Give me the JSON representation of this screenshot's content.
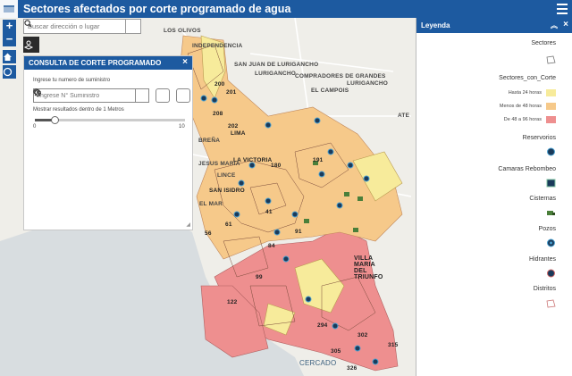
{
  "header": {
    "title": "Sectores afectados por corte programado de agua"
  },
  "search": {
    "placeholder": "Buscar dirección o lugar"
  },
  "map": {
    "labels": [
      "LOS OLIVOS",
      "INDEPENDENCIA",
      "SAN JUAN DE LURIGANCHO",
      "LURIGANCHO",
      "COMPRADORES DE GRANDES",
      "EL CAMPOIS",
      "LURIGANCHO",
      "ATE",
      "BREÑA",
      "LIMA",
      "LA VICTORIA",
      "JESUS MARIA",
      "LINCE",
      "SAN ISIDRO",
      "EL MAR",
      "VILLA MARIA DEL TRIUNFO",
      "CERCADO"
    ],
    "sector_numbers": [
      "201",
      "208",
      "202",
      "200",
      "191",
      "180",
      "61",
      "41",
      "56",
      "99",
      "122",
      "84",
      "315",
      "326",
      "302",
      "305",
      "294",
      "91"
    ],
    "colors": {
      "c24": "#f7eb9b",
      "c48": "#f6c98a",
      "c96": "#ee8f8f",
      "district": "#d8a48a"
    }
  },
  "panel": {
    "title": "CONSULTA DE CORTE PROGRAMADO",
    "ingrese_label": "Ingrese tu numero de suministro",
    "input_placeholder": "Ingrese N° Suministro",
    "results_label": "Mostrar resultados dentro de 1 Metros",
    "slider_min": "0",
    "slider_max": "10",
    "slider_value_fraction": 0.1
  },
  "legend": {
    "title": "Leyenda",
    "sectores": "Sectores",
    "sectores_con_corte": "Sectores_con_Corte",
    "items": [
      {
        "label": "Hasta 24 horas",
        "color": "#f7eb9b"
      },
      {
        "label": "Menos de 48 horas",
        "color": "#f6c98a"
      },
      {
        "label": "De 48 a 96 horas",
        "color": "#ee8f8f"
      }
    ],
    "reservorios": "Reservorios",
    "camaras": "Camaras Rebombeo",
    "cisternas": "Cisternas",
    "pozos": "Pozos",
    "hidrantes": "Hidrantes",
    "distritos": "Distritos"
  }
}
